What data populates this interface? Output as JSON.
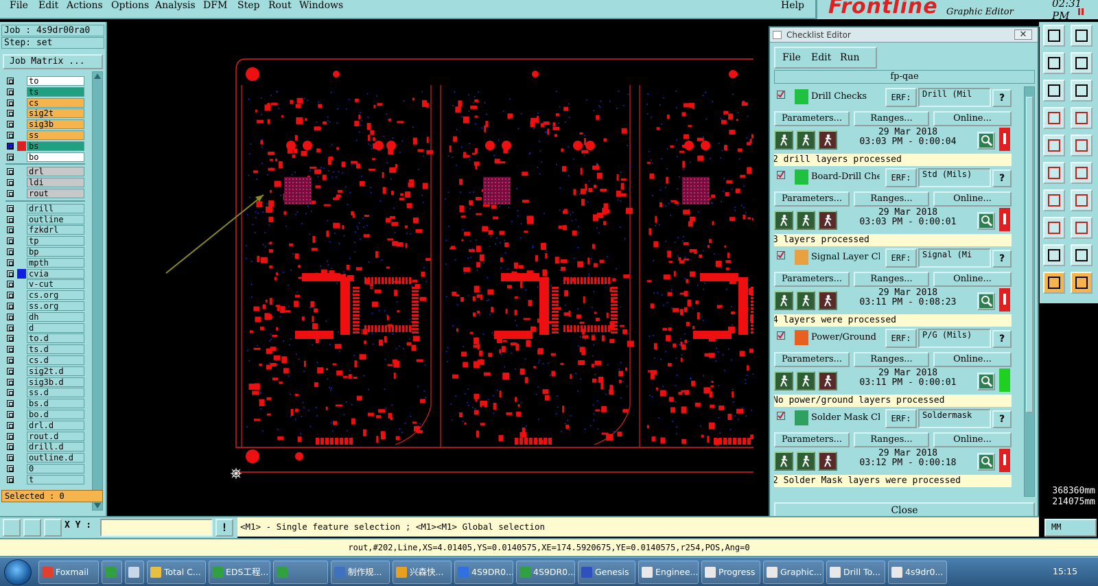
{
  "menubar": {
    "items": [
      "File",
      "Edit",
      "Actions",
      "Options",
      "Analysis",
      "DFM",
      "Step",
      "Rout",
      "Windows"
    ],
    "help": "Help"
  },
  "brand": {
    "logo": "Frontline",
    "subtitle": "Graphic Editor",
    "clock": "02:31 PM"
  },
  "left_panel": {
    "job": "Job : 4s9dr00ra0",
    "step": "Step: set",
    "job_matrix": "Job Matrix ...",
    "selected": "Selected : 0",
    "layers": [
      {
        "name": "to",
        "bg": "#ffffff",
        "swatch": null
      },
      {
        "name": "ts",
        "bg": "#20a080",
        "swatch": null
      },
      {
        "name": "cs",
        "bg": "#f5b44c",
        "swatch": null
      },
      {
        "name": "sig2t",
        "bg": "#f5b44c",
        "swatch": null
      },
      {
        "name": "sig3b",
        "bg": "#f5b44c",
        "swatch": null
      },
      {
        "name": "ss",
        "bg": "#f5b44c",
        "swatch": null
      },
      {
        "name": "bs",
        "bg": "#20a080",
        "swatch": "#e02020"
      },
      {
        "name": "bo",
        "bg": "#ffffff",
        "swatch": null
      },
      {
        "name": "drl",
        "bg": "#c8c8c8",
        "swatch": null
      },
      {
        "name": "ldi",
        "bg": "#c8c8c8",
        "swatch": null
      },
      {
        "name": "rout",
        "bg": "#c8c8c8",
        "swatch": null
      },
      {
        "name": "drill",
        "bg": "#a2dcdc",
        "swatch": null
      },
      {
        "name": "outline",
        "bg": "#a2dcdc",
        "swatch": null
      },
      {
        "name": "fzkdrl",
        "bg": "#a2dcdc",
        "swatch": null
      },
      {
        "name": "tp",
        "bg": "#a2dcdc",
        "swatch": null
      },
      {
        "name": "bp",
        "bg": "#a2dcdc",
        "swatch": null
      },
      {
        "name": "mpth",
        "bg": "#a2dcdc",
        "swatch": null
      },
      {
        "name": "cvia",
        "bg": "#a2dcdc",
        "swatch": "#1020e0"
      },
      {
        "name": "v-cut",
        "bg": "#a2dcdc",
        "swatch": null
      },
      {
        "name": "cs.org",
        "bg": "#a2dcdc",
        "swatch": null
      },
      {
        "name": "ss.org",
        "bg": "#a2dcdc",
        "swatch": null
      },
      {
        "name": "dh",
        "bg": "#a2dcdc",
        "swatch": null
      },
      {
        "name": "d",
        "bg": "#a2dcdc",
        "swatch": null
      },
      {
        "name": "to.d",
        "bg": "#a2dcdc",
        "swatch": null
      },
      {
        "name": "ts.d",
        "bg": "#a2dcdc",
        "swatch": null
      },
      {
        "name": "cs.d",
        "bg": "#a2dcdc",
        "swatch": null
      },
      {
        "name": "sig2t.d",
        "bg": "#a2dcdc",
        "swatch": null
      },
      {
        "name": "sig3b.d",
        "bg": "#a2dcdc",
        "swatch": null
      },
      {
        "name": "ss.d",
        "bg": "#a2dcdc",
        "swatch": null
      },
      {
        "name": "bs.d",
        "bg": "#a2dcdc",
        "swatch": null
      },
      {
        "name": "bo.d",
        "bg": "#a2dcdc",
        "swatch": null
      },
      {
        "name": "drl.d",
        "bg": "#a2dcdc",
        "swatch": null
      },
      {
        "name": "rout.d",
        "bg": "#a2dcdc",
        "swatch": null
      },
      {
        "name": "drill.d",
        "bg": "#a2dcdc",
        "swatch": null
      },
      {
        "name": "outline.d",
        "bg": "#a2dcdc",
        "swatch": null
      },
      {
        "name": "0",
        "bg": "#a2dcdc",
        "swatch": null
      },
      {
        "name": "t",
        "bg": "#a2dcdc",
        "swatch": null
      }
    ]
  },
  "checklist": {
    "title": "Checklist Editor",
    "menu": [
      "File",
      "Edit",
      "Run"
    ],
    "name": "fp-qae",
    "close": "Close",
    "erf_label": "ERF:",
    "help_label": "?",
    "buttons": [
      "Parameters...",
      "Ranges...",
      "Online..."
    ],
    "actions": [
      {
        "name": "Drill Checks",
        "erf": "Drill (Mil",
        "date": "29 Mar 2018",
        "time": "03:03 PM - 0:00:04",
        "status_color": "#e02020",
        "message": "2 drill layers processed",
        "icon_color": "#20c040"
      },
      {
        "name": "Board-Drill Che",
        "erf": "Std (Mils)",
        "date": "29 Mar 2018",
        "time": "03:03 PM - 0:00:01",
        "status_color": "#e02020",
        "message": "3 layers processed",
        "icon_color": "#20c040"
      },
      {
        "name": "Signal Layer Ch",
        "erf": "Signal (Mi",
        "date": "29 Mar 2018",
        "time": "03:11 PM - 0:08:23",
        "status_color": "#e02020",
        "message": "4 layers were processed",
        "icon_color": "#e8a040"
      },
      {
        "name": "Power/Ground C",
        "erf": "P/G (Mils)",
        "date": "29 Mar 2018",
        "time": "03:11 PM - 0:00:01",
        "status_color": "#20d020",
        "message": "No power/ground layers processed",
        "icon_color": "#e86020"
      },
      {
        "name": "Solder Mask Ch",
        "erf": "Soldermask",
        "date": "29 Mar 2018",
        "time": "03:12 PM - 0:00:18",
        "status_color": "#e02020",
        "message": "2 Solder Mask layers were processed",
        "icon_color": "#30a060"
      }
    ]
  },
  "coords": {
    "x": "368360mm",
    "y": "214075mm"
  },
  "units": "MM",
  "command": {
    "xy_label": "X Y :",
    "hint": "<M1> - Single feature selection ; <M1><M1> Global selection",
    "warn": "!"
  },
  "infobar": "rout,#202,Line,XS=4.01405,YS=0.0140575,XE=174.5920675,YE=0.0140575,r254,POS,Ang=0",
  "taskbar": {
    "items": [
      {
        "label": "Foxmail",
        "color": "#e04030"
      },
      {
        "label": "",
        "color": "#30a040"
      },
      {
        "label": "",
        "color": "#c8d8e8"
      },
      {
        "label": "Total C...",
        "color": "#e8c040"
      },
      {
        "label": "EDS工程...",
        "color": "#30a040"
      },
      {
        "label": "",
        "color": "#30a040"
      },
      {
        "label": "制作规...",
        "color": "#4070c0"
      },
      {
        "label": "兴森快...",
        "color": "#e8a020"
      },
      {
        "label": "4S9DR0...",
        "color": "#3070e0"
      },
      {
        "label": "4S9DR0...",
        "color": "#30a040"
      },
      {
        "label": "Genesis",
        "color": "#3050c0"
      },
      {
        "label": "Enginee...",
        "color": "#e8e8e8"
      },
      {
        "label": "Progress",
        "color": "#e8e8e8"
      },
      {
        "label": "Graphic...",
        "color": "#e8e8e8"
      },
      {
        "label": "Drill To...",
        "color": "#e8e8e8"
      },
      {
        "label": "4s9dr0...",
        "color": "#e8e8e8"
      }
    ],
    "time": "15:15"
  }
}
